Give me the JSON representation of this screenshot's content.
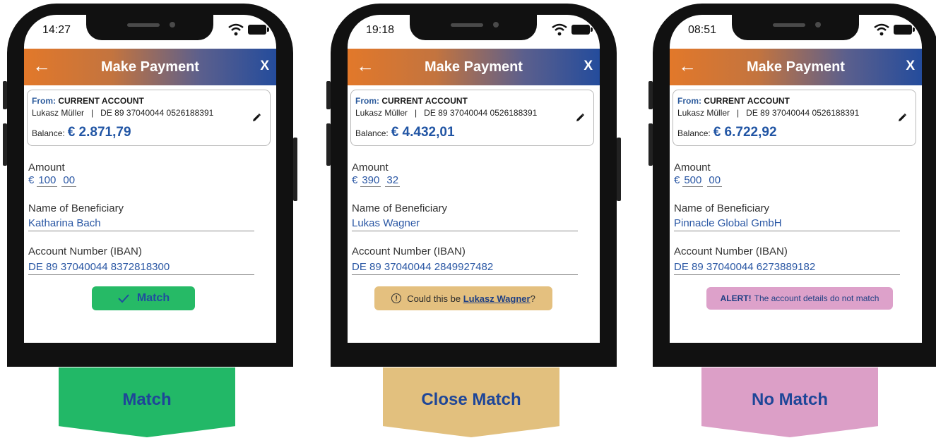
{
  "phones": [
    {
      "status_time": "14:27",
      "header": {
        "back_icon": "arrow-left-icon",
        "title": "Make Payment",
        "close_label": "X"
      },
      "account": {
        "from_label": "From:",
        "from_value": "CURRENT ACCOUNT",
        "details": "Lukasz Müller   |   DE 89 37040044 0526188391",
        "balance_label": "Balance:",
        "balance_value": "€ 2.871,79"
      },
      "amount": {
        "label": "Amount",
        "currency": "€",
        "integer": "100",
        "decimal": "00"
      },
      "beneficiary": {
        "label": "Name of Beneficiary",
        "value": "Katharina Bach"
      },
      "iban": {
        "label": "Account Number (IBAN)",
        "value": "DE 89 37040044 8372818300"
      },
      "result": {
        "type": "match",
        "icon": "check-icon",
        "text": "Match"
      }
    },
    {
      "status_time": "19:18",
      "header": {
        "back_icon": "arrow-left-icon",
        "title": "Make Payment",
        "close_label": "X"
      },
      "account": {
        "from_label": "From:",
        "from_value": "CURRENT ACCOUNT",
        "details": "Lukasz Müller   |   DE 89 37040044 0526188391",
        "balance_label": "Balance:",
        "balance_value": "€ 4.432,01"
      },
      "amount": {
        "label": "Amount",
        "currency": "€",
        "integer": "390",
        "decimal": "32"
      },
      "beneficiary": {
        "label": "Name of Beneficiary",
        "value": "Lukas Wagner"
      },
      "iban": {
        "label": "Account Number (IBAN)",
        "value": "DE 89 37040044 2849927482"
      },
      "result": {
        "type": "close",
        "icon": "info-icon",
        "text_pre": "Could this be ",
        "link_text": "Lukasz Wagner",
        "text_post": "?"
      }
    },
    {
      "status_time": "08:51",
      "header": {
        "back_icon": "arrow-left-icon",
        "title": "Make Payment",
        "close_label": "X"
      },
      "account": {
        "from_label": "From:",
        "from_value": "CURRENT ACCOUNT",
        "details": "Lukasz Müller   |   DE 89 37040044 0526188391",
        "balance_label": "Balance:",
        "balance_value": "€ 6.722,92"
      },
      "amount": {
        "label": "Amount",
        "currency": "€",
        "integer": "500",
        "decimal": "00"
      },
      "beneficiary": {
        "label": "Name of Beneficiary",
        "value": "Pinnacle Global GmbH"
      },
      "iban": {
        "label": "Account Number (IBAN)",
        "value": "DE 89 37040044 6273889182"
      },
      "result": {
        "type": "alert",
        "strong": "ALERT!",
        "text": "The account details do not match"
      }
    }
  ],
  "tags": [
    {
      "label": "Match",
      "color": "#22b867"
    },
    {
      "label": "Close Match",
      "color": "#e2c07e"
    },
    {
      "label": "No Match",
      "color": "#dc9fc7"
    }
  ],
  "colors": {
    "header_start": "#e2782a",
    "header_end": "#244c9c",
    "value_blue": "#2155a4"
  }
}
